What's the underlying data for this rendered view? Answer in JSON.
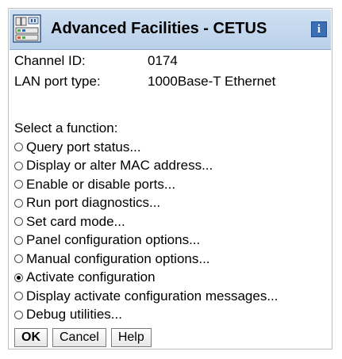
{
  "window": {
    "title": "Advanced Facilities - CETUS",
    "icon": "network-adapter-icon",
    "info_icon": "info-icon",
    "info_glyph": "i",
    "titlebar_color": "#c4d7ee"
  },
  "fields": {
    "channel_id": {
      "label": "Channel ID:",
      "value": "0174"
    },
    "lan_port_type": {
      "label": "LAN port type:",
      "value": "1000Base-T Ethernet"
    }
  },
  "functions": {
    "prompt": "Select a function:",
    "options": [
      {
        "label": "Query port status...",
        "selected": false
      },
      {
        "label": "Display or alter MAC address...",
        "selected": false
      },
      {
        "label": "Enable or disable ports...",
        "selected": false
      },
      {
        "label": "Run port diagnostics...",
        "selected": false
      },
      {
        "label": "Set card mode...",
        "selected": false
      },
      {
        "label": "Panel configuration options...",
        "selected": false
      },
      {
        "label": "Manual configuration options...",
        "selected": false
      },
      {
        "label": "Activate configuration",
        "selected": true
      },
      {
        "label": "Display activate configuration messages...",
        "selected": false
      },
      {
        "label": "Debug utilities...",
        "selected": false
      }
    ]
  },
  "buttons": {
    "ok": "OK",
    "cancel": "Cancel",
    "help": "Help"
  }
}
